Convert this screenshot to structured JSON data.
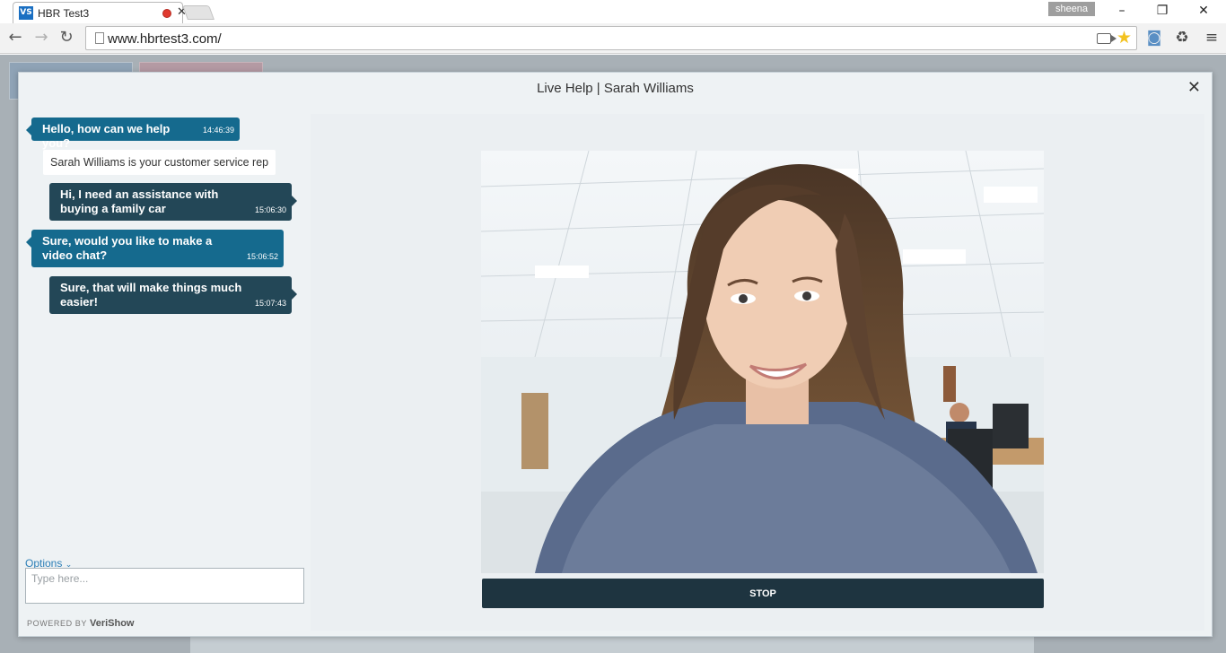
{
  "browser": {
    "tab_title": "HBR Test3",
    "tab_favicon": "VS",
    "profile_name": "sheena",
    "url": "www.hbrtest3.com/"
  },
  "modal": {
    "title": "Live Help | Sarah Williams",
    "close_glyph": "✕"
  },
  "chat": {
    "messages": [
      {
        "sender": "agent",
        "text": "Hello, how can we help you?",
        "time": "14:46:39"
      },
      {
        "sender": "system",
        "text": "Sarah Williams is your customer service rep"
      },
      {
        "sender": "user",
        "text": "Hi, I need an assistance with buying a family car",
        "time": "15:06:30"
      },
      {
        "sender": "agent",
        "text": "Sure, would you like to make a video chat?",
        "time": "15:06:52"
      },
      {
        "sender": "user",
        "text": "Sure, that will make things much easier!",
        "time": "15:07:43"
      }
    ],
    "options_label": "Options",
    "input_placeholder": "Type here...",
    "powered_by": "POWERED BY",
    "brand": "VeriShow"
  },
  "video": {
    "stop_label": "STOP"
  },
  "colors": {
    "agent_bubble": "#156a8e",
    "user_bubble": "#234757",
    "stop_button": "#1e3440",
    "link": "#2d7fb7"
  }
}
